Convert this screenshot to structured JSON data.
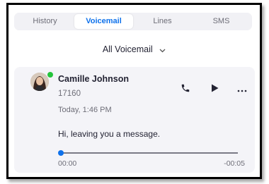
{
  "tabs": [
    {
      "label": "History",
      "active": false
    },
    {
      "label": "Voicemail",
      "active": true
    },
    {
      "label": "Lines",
      "active": false
    },
    {
      "label": "SMS",
      "active": false
    }
  ],
  "filter": {
    "label": "All Voicemail",
    "icon": "chevron-down-icon"
  },
  "voicemail": {
    "caller_name": "Camille Johnson",
    "caller_number": "17160",
    "timestamp": "Today, 1:46 PM",
    "transcript": "Hi, leaving you a message.",
    "presence": "online",
    "actions": [
      "phone-icon",
      "play-icon",
      "more-icon"
    ],
    "player": {
      "current_time": "00:00",
      "remaining_time": "-00:05",
      "progress": 0
    }
  },
  "colors": {
    "accent": "#0e71eb",
    "presence_online": "#24c43b",
    "card_background": "#f4f4f8"
  }
}
